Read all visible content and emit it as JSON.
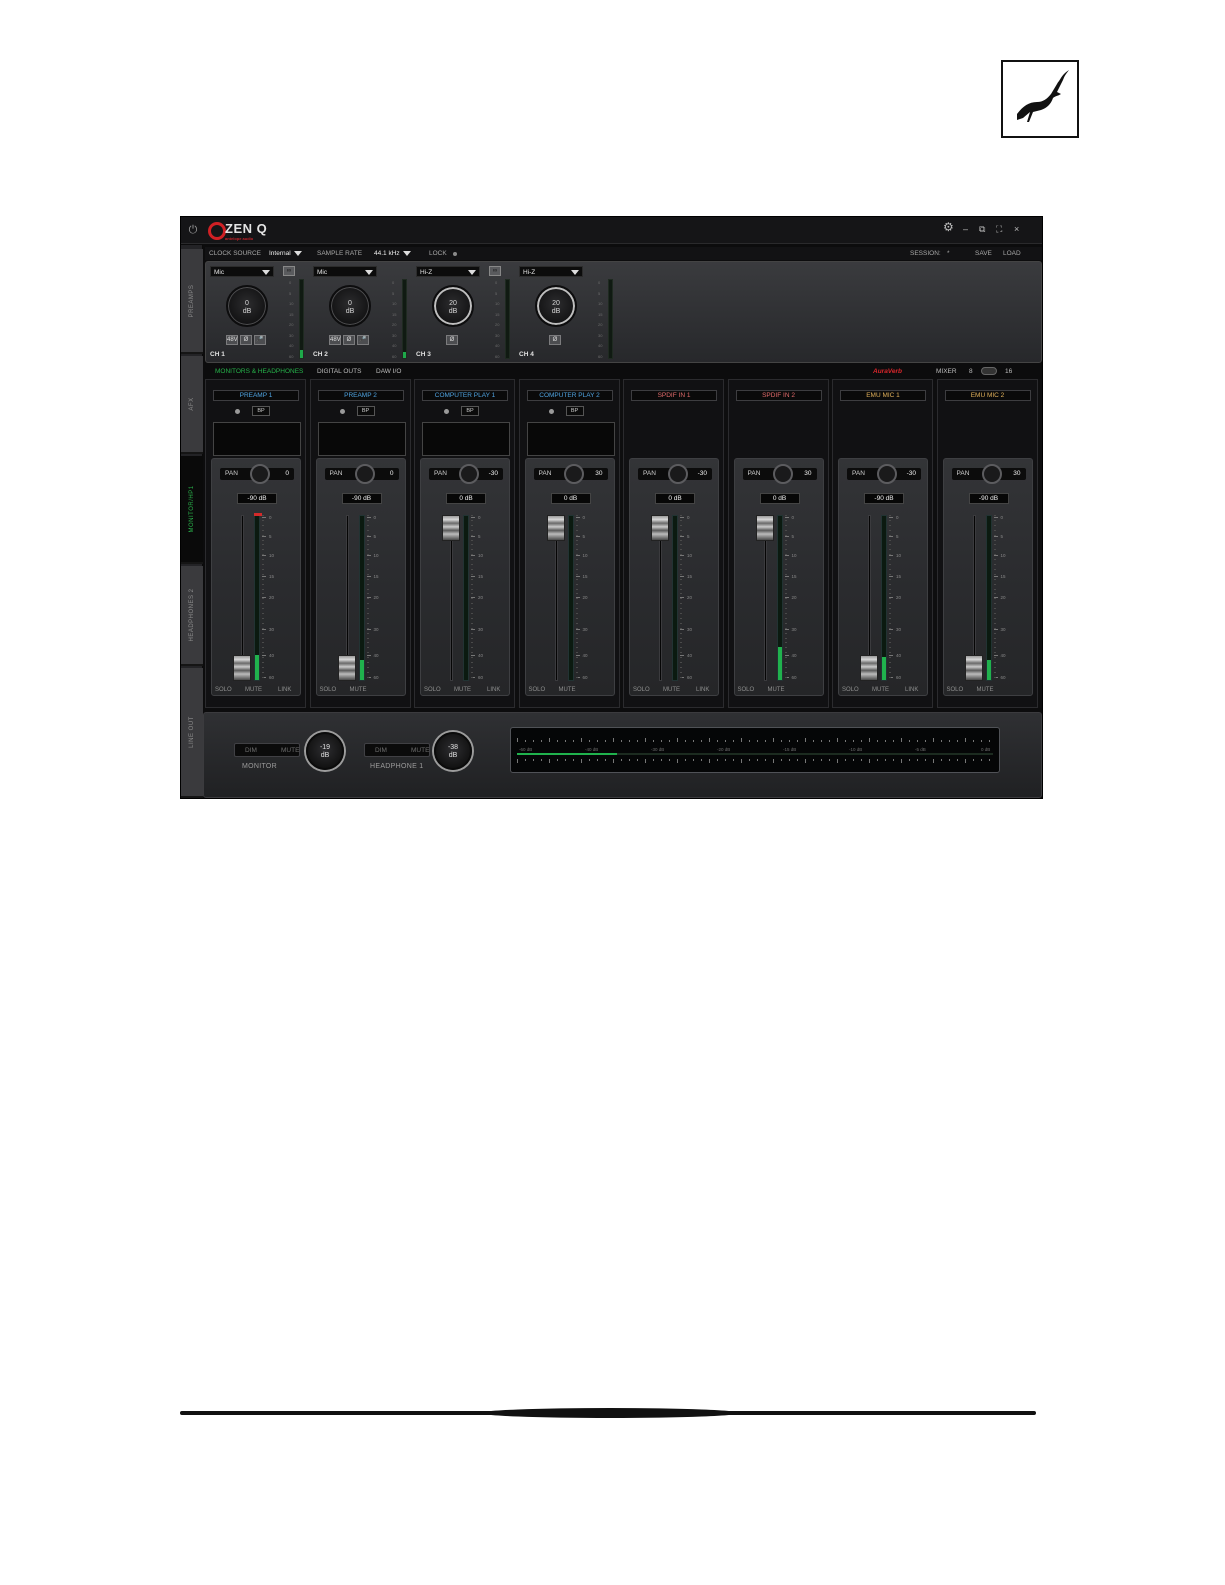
{
  "app": {
    "brand": "ZEN Q",
    "brand_sub": "antelope audio",
    "window_controls": {
      "settings": "⚙",
      "minimize": "–",
      "restore": "⧉",
      "fullscreen": "⛶",
      "close": "×"
    }
  },
  "clock": {
    "source_label": "CLOCK SOURCE",
    "source_value": "Internal",
    "rate_label": "SAMPLE RATE",
    "rate_value": "44.1 kHz",
    "lock_label": "LOCK",
    "session_label": "SESSION:",
    "session_value": "*",
    "save": "SAVE",
    "load": "LOAD"
  },
  "sidebar": {
    "tabs": [
      "PREAMPS",
      "AFX",
      "MONITOR/HP1",
      "HEADPHONES 2",
      "LINE OUT"
    ],
    "active": "MONITOR/HP1"
  },
  "preamps": [
    {
      "type": "Mic",
      "gain": "0",
      "unit": "dB",
      "label": "CH 1",
      "buttons": [
        "48V",
        "Ø",
        "🎤"
      ],
      "meter": 0.1
    },
    {
      "type": "Mic",
      "gain": "0",
      "unit": "dB",
      "label": "CH 2",
      "buttons": [
        "48V",
        "Ø",
        "🎤"
      ],
      "meter": 0.08
    },
    {
      "type": "Hi-Z",
      "gain": "20",
      "unit": "dB",
      "label": "CH 3",
      "buttons": [
        "Ø"
      ],
      "meter": 0
    },
    {
      "type": "Hi-Z",
      "gain": "20",
      "unit": "dB",
      "label": "CH 4",
      "buttons": [
        "Ø"
      ],
      "meter": 0
    }
  ],
  "meter_scale_pre": [
    "0",
    "5",
    "10",
    "15",
    "20",
    "30",
    "40",
    "60"
  ],
  "tabs": {
    "items": [
      "MONITORS & HEADPHONES",
      "DIGITAL OUTS",
      "DAW I/O"
    ],
    "active": "MONITORS & HEADPHONES",
    "aura": "AuraVerb",
    "mixer_label": "MIXER",
    "mixer_a": "8",
    "mixer_b": "16"
  },
  "strips": [
    {
      "name": "PREAMP 1",
      "color": "#4fa3e0",
      "bp": "BP",
      "pan": "0",
      "db": "-90 dB",
      "fader": 0.0,
      "meter": 0.15,
      "peak": true,
      "link": "LINK"
    },
    {
      "name": "PREAMP 2",
      "color": "#4fa3e0",
      "bp": "BP",
      "pan": "0",
      "db": "-90 dB",
      "fader": 0.0,
      "meter": 0.12,
      "peak": false,
      "link": ""
    },
    {
      "name": "COMPUTER PLAY 1",
      "color": "#4fa3e0",
      "bp": "BP",
      "pan": "-30",
      "db": "0 dB",
      "fader": 1.0,
      "meter": 0,
      "peak": false,
      "link": "LINK"
    },
    {
      "name": "COMPUTER PLAY 2",
      "color": "#4fa3e0",
      "bp": "BP",
      "pan": "30",
      "db": "0 dB",
      "fader": 1.0,
      "meter": 0,
      "peak": false,
      "link": ""
    },
    {
      "name": "SPDIF IN 1",
      "color": "#e26b6b",
      "bp": "",
      "pan": "-30",
      "db": "0 dB",
      "fader": 1.0,
      "meter": 0,
      "peak": false,
      "link": "LINK"
    },
    {
      "name": "SPDIF IN 2",
      "color": "#e26b6b",
      "bp": "",
      "pan": "30",
      "db": "0 dB",
      "fader": 1.0,
      "meter": 0.2,
      "peak": false,
      "link": ""
    },
    {
      "name": "EMU MIC 1",
      "color": "#e0b05a",
      "bp": "",
      "pan": "-30",
      "db": "-90 dB",
      "fader": 0.0,
      "meter": 0.14,
      "peak": false,
      "link": "LINK"
    },
    {
      "name": "EMU MIC 2",
      "color": "#e0b05a",
      "bp": "",
      "pan": "30",
      "db": "-90 dB",
      "fader": 0.0,
      "meter": 0.12,
      "peak": false,
      "link": ""
    }
  ],
  "strip_labels": {
    "pan": "PAN",
    "solo": "SOLO",
    "mute": "MUTE"
  },
  "meter_scale": [
    "0",
    "5",
    "10",
    "15",
    "20",
    "30",
    "40",
    "60"
  ],
  "monitor": {
    "dim": "DIM",
    "mute": "MUTE",
    "value": "-19",
    "unit": "dB",
    "label": "MONITOR"
  },
  "headphone": {
    "dim": "DIM",
    "mute": "MUTE",
    "value": "-38",
    "unit": "dB",
    "label": "HEADPHONE 1"
  },
  "big_meter": {
    "scale": [
      "-60 dB",
      "-40 dB",
      "-30 dB",
      "-20 dB",
      "-15 dB",
      "-10 dB",
      "-5 dB",
      "0 dB"
    ],
    "level": 0.21
  }
}
